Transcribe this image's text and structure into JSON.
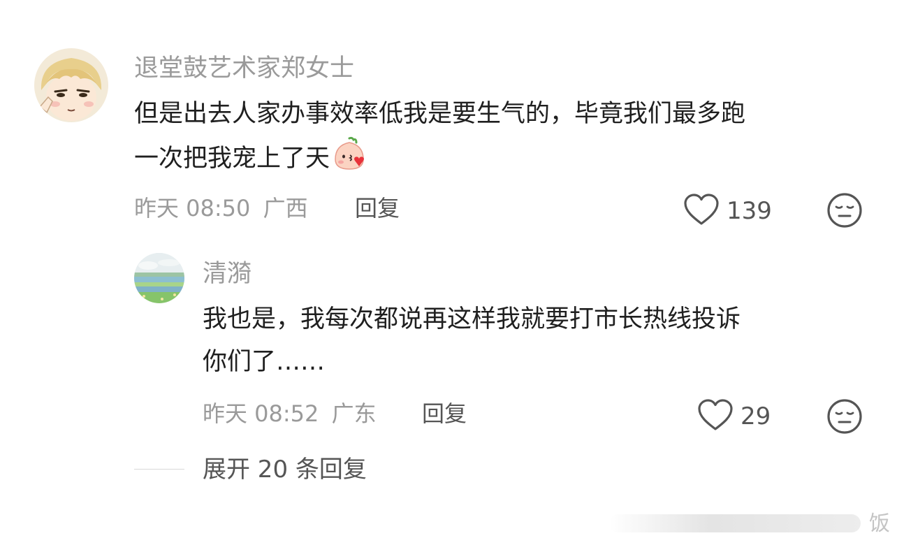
{
  "comments": [
    {
      "username": "退堂鼓艺术家郑女士",
      "text_lines": [
        "但是出去人家办事效率低我是要生气的，毕竟我们最多跑",
        "一次把我宠上了天"
      ],
      "emoji_icon": "blow-kiss-peach-emoji",
      "time": "昨天 08:50",
      "location": "广西",
      "reply_label": "回复",
      "likes": "139",
      "avatar_icon": "anime-character-avatar"
    },
    {
      "username": "清漪",
      "text_lines": [
        "我也是，我每次都说再这样我就要打市长热线投诉",
        "你们了……"
      ],
      "time": "昨天 08:52",
      "location": "广东",
      "reply_label": "回复",
      "likes": "29",
      "avatar_icon": "landscape-avatar"
    }
  ],
  "expand_replies": "展开 20 条回复",
  "watermark": "饭",
  "colors": {
    "secondary_text": "#9a9a9a",
    "primary_text": "#1f1f1f",
    "action_text": "#555555"
  }
}
